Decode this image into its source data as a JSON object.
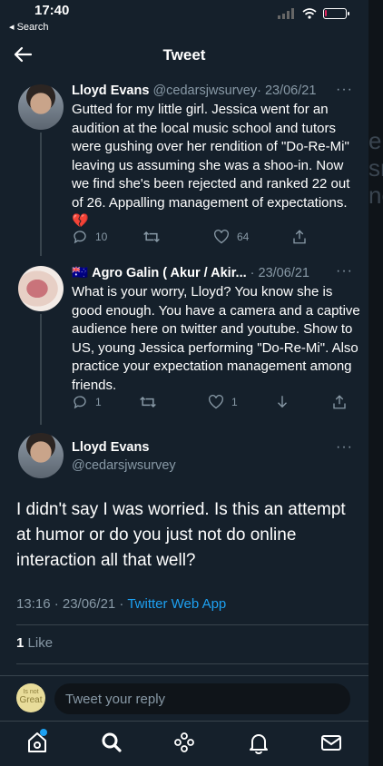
{
  "status_bar": {
    "time": "17:40",
    "back_label": "◂ Search"
  },
  "header": {
    "title": "Tweet"
  },
  "tweets": [
    {
      "name": "Lloyd Evans",
      "handle": "@cedarsjwsurvey",
      "date": "· 23/06/21",
      "text": "Gutted for my little girl. Jessica went for an audition at the local music school and tutors were gushing over her rendition of \"Do-Re-Mi\" leaving us assuming she was a shoo-in. Now we find she's been rejected and ranked 22 out of 26. Appalling management of expectations. 💔",
      "replies": "10",
      "retweets": "",
      "likes": "64"
    },
    {
      "flag": "🇦🇺",
      "name": "Agro Galin ( Akur / Akir...",
      "date": "· 23/06/21",
      "text": "What is your worry, Lloyd? You know she is good enough. You have a camera and a captive audience here on twitter and youtube. Show to US, young Jessica performing \"Do-Re-Mi\". Also practice your expectation management among friends.",
      "replies": "1",
      "retweets": "",
      "likes": "1"
    }
  ],
  "main_tweet": {
    "name": "Lloyd Evans",
    "handle": "@cedarsjwsurvey",
    "text": "I didn't say I was worried. Is this an attempt at humor or do you just not do online interaction all that well?",
    "timestamp": "13:16 · 23/06/21 ·",
    "source": "Twitter Web App",
    "likes_count": "1",
    "likes_label": "Like"
  },
  "reply_bar": {
    "avatar_line1": "Is not",
    "avatar_line2": "Great",
    "placeholder": "Tweet your reply"
  },
  "tabs": [
    "home-icon",
    "search-icon",
    "spaces-icon",
    "notifications-icon",
    "messages-icon"
  ],
  "colors": {
    "background": "#15202b",
    "accent": "#1da1f2",
    "secondary_text": "#8899a6",
    "border": "#38444d"
  }
}
